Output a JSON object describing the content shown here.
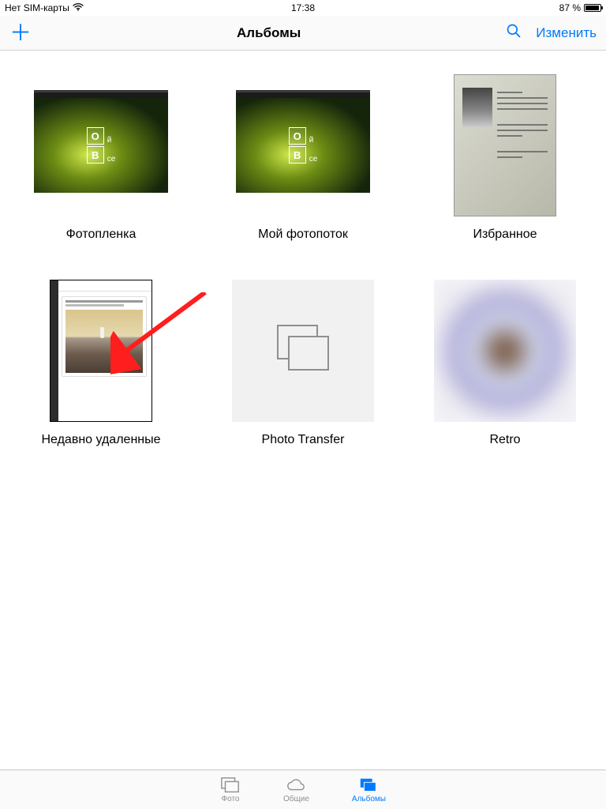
{
  "status": {
    "carrier": "Нет SIM-карты",
    "time": "17:38",
    "battery_pct": "87 %"
  },
  "navbar": {
    "title": "Альбомы",
    "edit_label": "Изменить"
  },
  "albums": [
    {
      "label": "Фотопленка"
    },
    {
      "label": "Мой фотопоток"
    },
    {
      "label": "Избранное"
    },
    {
      "label": "Недавно удаленные"
    },
    {
      "label": "Photo Transfer"
    },
    {
      "label": "Retro"
    }
  ],
  "tile_text": {
    "o": "О",
    "y": "й",
    "v": "В",
    "s": "се"
  },
  "tabs": {
    "photos": "Фото",
    "shared": "Общие",
    "albums": "Альбомы"
  },
  "colors": {
    "accent": "#007aff"
  }
}
